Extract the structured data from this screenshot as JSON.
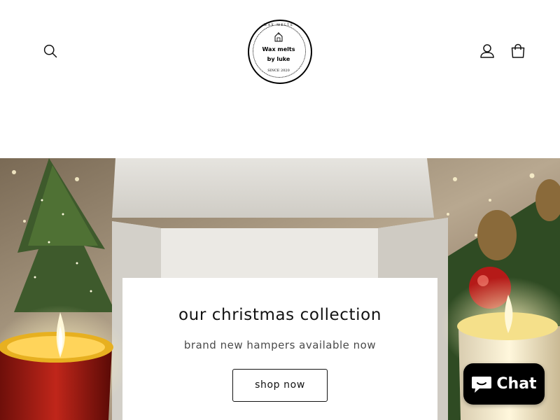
{
  "header": {
    "logo": {
      "arc_text": "WAX MELTS",
      "line1": "Wax melts",
      "line2": "by luke",
      "since": "SINCE 2020"
    },
    "icons": {
      "search": "search-icon",
      "account": "account-icon",
      "cart": "cart-icon"
    }
  },
  "hero": {
    "title": "our christmas collection",
    "subtitle": "brand new hampers available now",
    "button_label": "shop now"
  },
  "chat": {
    "label": "Chat",
    "icon": "chat-bubble-icon"
  },
  "colors": {
    "text": "#121212",
    "chat_bg": "#000000",
    "page_bg": "#ffffff"
  }
}
